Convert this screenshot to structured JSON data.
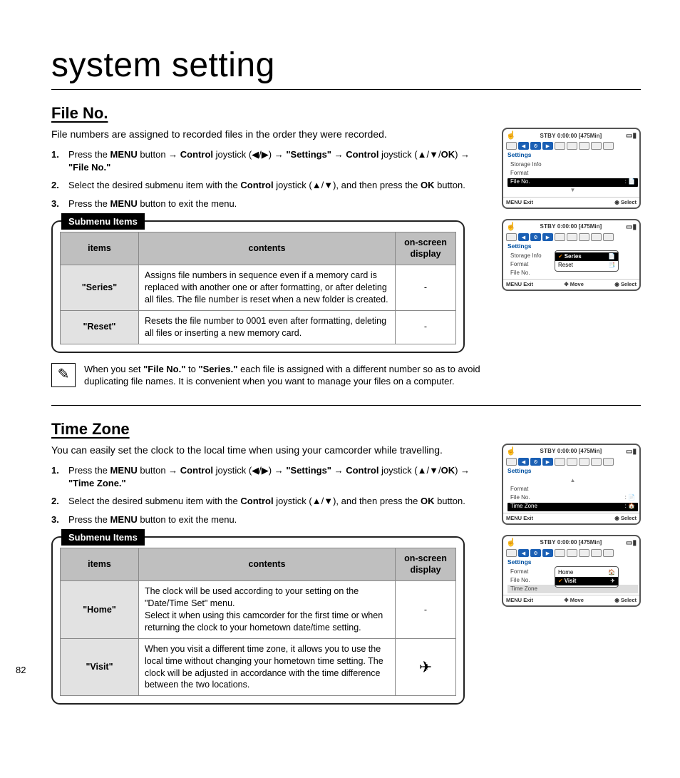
{
  "page": {
    "number": "82"
  },
  "chapter_title": "system setting",
  "section1": {
    "heading": "File No.",
    "intro": "File numbers are assigned to recorded files in the order they were recorded.",
    "step1_a": "Press the ",
    "step1_menu": "MENU",
    "step1_b": " button → ",
    "step1_ctrl": "Control",
    "step1_c": " joystick (◀/▶) → ",
    "step1_set": "\"Settings\"",
    "step1_d": " → ",
    "step1_ctrl2": "Control",
    "step1_e": " joystick (▲/▼/",
    "step1_ok": "OK",
    "step1_f": ") → ",
    "step1_fileno": "\"File No.\"",
    "step2_a": "Select the desired submenu item with the ",
    "step2_ctrl": "Control",
    "step2_b": " joystick (▲/▼), and then press the ",
    "step2_ok": "OK",
    "step2_c": " button.",
    "step3_a": "Press the ",
    "step3_menu": "MENU",
    "step3_b": " button to exit the menu.",
    "submenu_label": "Submenu Items",
    "th_items": "items",
    "th_contents": "contents",
    "th_osd": "on-screen display",
    "row1_item": "\"Series\"",
    "row1_contents": "Assigns file numbers in sequence even if a memory card is replaced with another one or after formatting, or after deleting all files. The file number is reset when a new folder is created.",
    "row1_osd": "-",
    "row2_item": "\"Reset\"",
    "row2_contents": "Resets the file number to 0001 even after formatting, deleting all files or inserting a new memory card.",
    "row2_osd": "-",
    "note_a": "When you set ",
    "note_fn": "\"File No.\"",
    "note_b": " to ",
    "note_series": "\"Series.\"",
    "note_c": " each file is assigned with a different number so as to avoid duplicating file names. It is convenient when you want to manage your files on a computer."
  },
  "section2": {
    "heading": "Time Zone",
    "intro": "You can easily set the clock to the local time when using your camcorder while travelling.",
    "step1_a": "Press the ",
    "step1_menu": "MENU",
    "step1_b": " button → ",
    "step1_ctrl": "Control",
    "step1_c": " joystick (◀/▶) → ",
    "step1_set": "\"Settings\"",
    "step1_d": " → ",
    "step1_ctrl2": "Control",
    "step1_e": " joystick (▲/▼/",
    "step1_ok": "OK",
    "step1_f": ") → ",
    "step1_tz": "\"Time Zone.\"",
    "step2_a": "Select the desired submenu item with the ",
    "step2_ctrl": "Control",
    "step2_b": " joystick (▲/▼), and then press the ",
    "step2_ok": "OK",
    "step2_c": " button.",
    "step3_a": "Press the ",
    "step3_menu": "MENU",
    "step3_b": " button to exit the menu.",
    "submenu_label": "Submenu Items",
    "th_items": "items",
    "th_contents": "contents",
    "th_osd": "on-screen display",
    "row1_item": "\"Home\"",
    "row1_contents": "The clock will be used according to your setting on the \"Date/Time Set\" menu.\nSelect it when using this camcorder for the first time or when returning the clock to your hometown date/time setting.",
    "row1_osd": "-",
    "row2_item": "\"Visit\"",
    "row2_contents": "When you visit a different time zone, it allows you to use the local time without changing your hometown time setting. The clock will be adjusted in accordance with the time difference between the two locations.",
    "row2_osd": "✈"
  },
  "osd": {
    "status": "STBY",
    "time": "0:00:00",
    "remain": "[475Min]",
    "section": "Settings",
    "storage": "Storage Info",
    "format": "Format",
    "fileno": "File No.",
    "timezone": "Time Zone",
    "series": "Series",
    "reset": "Reset",
    "home": "Home",
    "visit": "Visit",
    "menu": "MENU",
    "exit": "Exit",
    "move": "Move",
    "select": "Select"
  }
}
